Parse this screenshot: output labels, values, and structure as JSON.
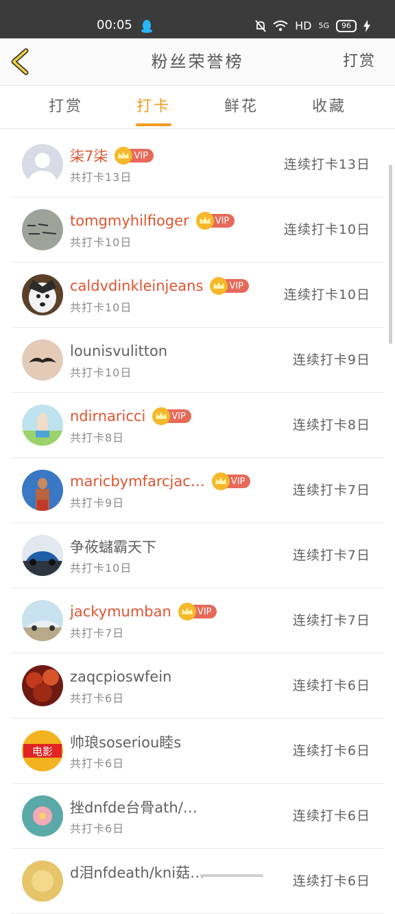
{
  "status": {
    "time": "00:05",
    "network": "HD",
    "signal": "5G",
    "battery": "96"
  },
  "header": {
    "title": "粉丝荣誉榜",
    "action": "打赏"
  },
  "tabs": [
    {
      "label": "打赏",
      "active": false
    },
    {
      "label": "打卡",
      "active": true
    },
    {
      "label": "鲜花",
      "active": false
    },
    {
      "label": "收藏",
      "active": false
    }
  ],
  "vip_label": "VIP",
  "colors": {
    "accent": "#f29b1f",
    "vip_name": "#e0532e",
    "vip_badge": "#e66a5a"
  },
  "rows": [
    {
      "name": "柒7柒",
      "vip": true,
      "total": "共打卡13日",
      "streak": "连续打卡13日",
      "avatar_icon": "default-avatar-icon"
    },
    {
      "name": "tomgmyhilfioger",
      "vip": true,
      "total": "共打卡10日",
      "streak": "连续打卡10日",
      "avatar_icon": "handwriting-avatar"
    },
    {
      "name": "caldvdinkleinjeans",
      "vip": true,
      "total": "共打卡10日",
      "streak": "连续打卡10日",
      "avatar_icon": "husky-dog-avatar"
    },
    {
      "name": "lounisvulitton",
      "vip": false,
      "total": "共打卡10日",
      "streak": "连续打卡9日",
      "avatar_icon": "mustache-avatar"
    },
    {
      "name": "ndirnaricci",
      "vip": true,
      "total": "共打卡8日",
      "streak": "连续打卡8日",
      "avatar_icon": "girl-field-avatar"
    },
    {
      "name": "maricbymfarcjac…",
      "vip": true,
      "total": "共打卡9日",
      "streak": "连续打卡7日",
      "avatar_icon": "muscle-man-avatar"
    },
    {
      "name": "争莜蠩霸天下",
      "vip": false,
      "total": "共打卡10日",
      "streak": "连续打卡7日",
      "avatar_icon": "blue-car-avatar"
    },
    {
      "name": "jackymumban",
      "vip": true,
      "total": "共打卡7日",
      "streak": "连续打卡7日",
      "avatar_icon": "sports-car-avatar"
    },
    {
      "name": "zaqcpioswfein",
      "vip": false,
      "total": "共打卡6日",
      "streak": "连续打卡6日",
      "avatar_icon": "autumn-trees-avatar"
    },
    {
      "name": "帅琅soseriou睦s",
      "vip": false,
      "total": "共打卡6日",
      "streak": "连续打卡6日",
      "avatar_icon": "movie-logo-avatar"
    },
    {
      "name": "挫dnfde台骨ath/…",
      "vip": false,
      "total": "共打卡6日",
      "streak": "连续打卡6日",
      "avatar_icon": "flower-avatar"
    },
    {
      "name": "d泪nfdeath/kni菇…",
      "vip": false,
      "total": "",
      "streak": "连续打卡6日",
      "avatar_icon": "gold-avatar"
    }
  ]
}
